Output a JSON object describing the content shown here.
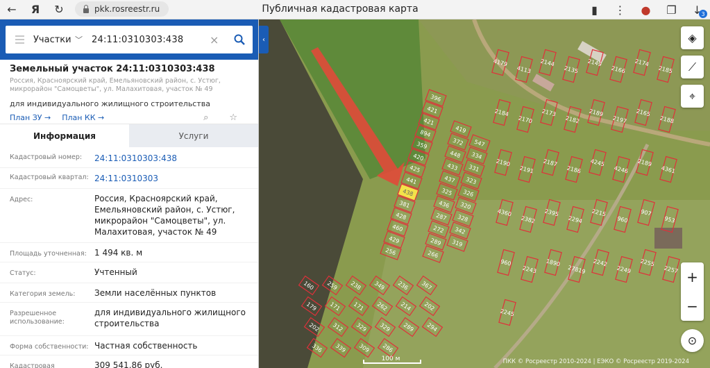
{
  "browser": {
    "url": "pkk.rosreestr.ru",
    "title": "Публичная кадастровая карта",
    "downloads_badge": "3"
  },
  "search": {
    "type": "Участки",
    "value": "24:11:0310303:438"
  },
  "object": {
    "title": "Земельный участок 24:11:0310303:438",
    "address_short": "Россия, Красноярский край, Емельяновский район, с. Устюг, микрорайон \"Самоцветы\", ул. Малахитовая, участок № 49",
    "use": "для индивидуального жилищного строительства",
    "plan_zu": "План ЗУ →",
    "plan_kk": "План КК →"
  },
  "tabs": {
    "info": "Информация",
    "services": "Услуги"
  },
  "rows": [
    {
      "label": "Кадастровый номер:",
      "value": "24:11:0310303:438"
    },
    {
      "label": "Кадастровый квартал:",
      "value": "24:11:0310303"
    },
    {
      "label": "Адрес:",
      "value": "Россия, Красноярский край, Емельяновский район, с. Устюг, микрорайон \"Самоцветы\", ул. Малахитовая, участок № 49"
    },
    {
      "label": "Площадь уточненная:",
      "value": "1 494 кв. м"
    },
    {
      "label": "Статус:",
      "value": "Учтенный"
    },
    {
      "label": "Категория земель:",
      "value": "Земли населённых пунктов"
    },
    {
      "label": "Разрешенное использование:",
      "value": "для индивидуального жилищного строительства"
    },
    {
      "label": "Форма собственности:",
      "value": "Частная собственность"
    },
    {
      "label": "Кадастровая стоимость:",
      "value": "309 541,86 руб."
    }
  ],
  "map": {
    "scale": "100 м",
    "copyright": "ПКК © Росреестр 2010-2024 | ЕЭКО © Росреестр 2019-2024",
    "parcels_col1": [
      "396",
      "421",
      "421",
      "894",
      "359",
      "420",
      "425",
      "441",
      "438",
      "381",
      "428",
      "460",
      "429",
      "256"
    ],
    "parcels_col2": [
      "419",
      "372",
      "448",
      "433",
      "437",
      "325",
      "436",
      "287",
      "272",
      "289",
      "266"
    ],
    "parcels_col3": [
      "547",
      "334",
      "331",
      "323",
      "326",
      "320",
      "328",
      "342",
      "319"
    ],
    "parcels_right": [
      "4179",
      "4113",
      "2144",
      "2135",
      "2149",
      "2166",
      "2174",
      "2185",
      "2184",
      "2170",
      "2173",
      "2182",
      "2189",
      "2197",
      "2165",
      "2188",
      "2190",
      "2191",
      "2187",
      "2186",
      "4245",
      "4246",
      "2189",
      "4361",
      "4360",
      "2382",
      "2395",
      "2294",
      "2215",
      "960",
      "907",
      "953",
      "960",
      "2243",
      "1890",
      "27819",
      "2242",
      "2249",
      "2255",
      "2257",
      "2245"
    ],
    "parcels_bottom": [
      "160",
      "259",
      "238",
      "349",
      "236",
      "367",
      "179",
      "171",
      "171",
      "262",
      "214",
      "202",
      "202",
      "312",
      "329",
      "329",
      "289",
      "294",
      "336",
      "339",
      "309",
      "286"
    ]
  }
}
